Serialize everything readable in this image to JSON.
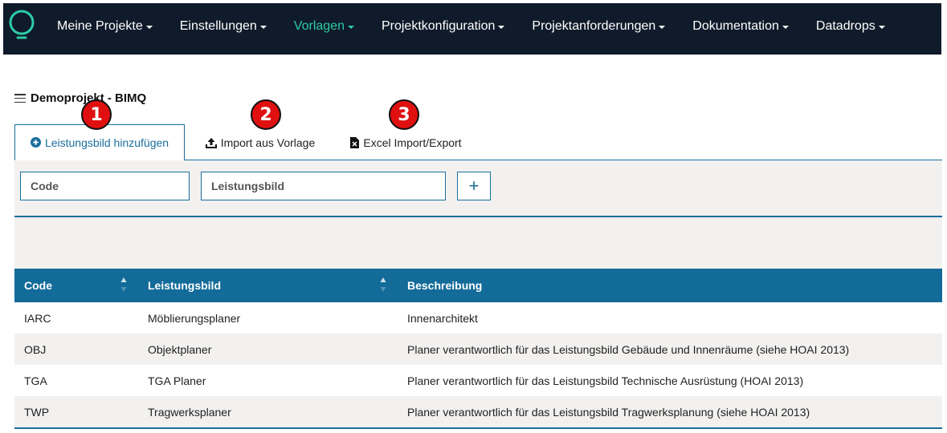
{
  "nav": {
    "items": [
      {
        "label": "Meine Projekte"
      },
      {
        "label": "Einstellungen"
      },
      {
        "label": "Vorlagen"
      },
      {
        "label": "Projektkonfiguration"
      },
      {
        "label": "Projektanforderungen"
      },
      {
        "label": "Dokumentation"
      },
      {
        "label": "Datadrops"
      }
    ],
    "active_index": 2,
    "colors": {
      "background": "#0f1b2a",
      "active": "#2ecba5",
      "logo": "#2ecba5"
    }
  },
  "project": {
    "title": "Demoprojekt - BIMQ"
  },
  "tabs": [
    {
      "label": "Leistungsbild hinzufügen",
      "icon": "plus-circle-icon"
    },
    {
      "label": "Import aus Vorlage",
      "icon": "upload-icon"
    },
    {
      "label": "Excel Import/Export",
      "icon": "excel-file-icon"
    }
  ],
  "markers": [
    "1",
    "2",
    "3"
  ],
  "form": {
    "code_placeholder": "Code",
    "leistungsbild_placeholder": "Leistungsbild",
    "add_label": "+"
  },
  "table": {
    "headers": {
      "code": "Code",
      "leistungsbild": "Leistungsbild",
      "beschreibung": "Beschreibung"
    },
    "rows": [
      {
        "code": "IARC",
        "leistungsbild": "Möblierungsplaner",
        "beschreibung": "Innenarchitekt"
      },
      {
        "code": "OBJ",
        "leistungsbild": "Objektplaner",
        "beschreibung": "Planer verantwortlich für das Leistungsbild Gebäude und Innenräume (siehe HOAI 2013)"
      },
      {
        "code": "TGA",
        "leistungsbild": "TGA Planer",
        "beschreibung": "Planer verantwortlich für das Leistungsbild Technische Ausrüstung (HOAI 2013)"
      },
      {
        "code": "TWP",
        "leistungsbild": "Tragwerksplaner",
        "beschreibung": "Planer verantwortlich für das Leistungsbild Tragwerksplanung (siehe HOAI 2013)"
      }
    ],
    "colors": {
      "header": "#136b99",
      "alt_row": "#f2f1f0"
    }
  }
}
